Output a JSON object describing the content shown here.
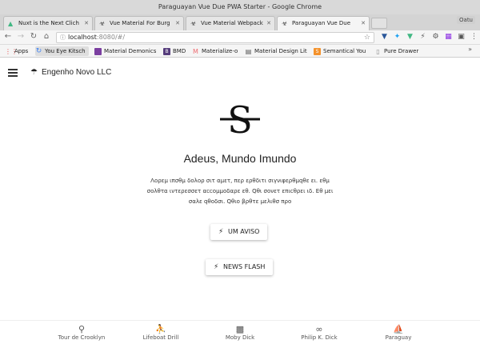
{
  "window": {
    "title": "Paraguayan Vue Due PWA Starter - Google Chrome",
    "user_badge": "Oatu"
  },
  "tabs": [
    {
      "label": "Nuxt is the Next Clich",
      "icon": "nuxt-icon"
    },
    {
      "label": "Vue Material For Burg",
      "icon": "biohazard-icon"
    },
    {
      "label": "Vue Material Webpack",
      "icon": "biohazard-icon"
    },
    {
      "label": "Paraguayan Vue Due",
      "icon": "biohazard-icon"
    }
  ],
  "address": {
    "host": "localhost",
    "path": ":8080/#/"
  },
  "bookmarks": [
    {
      "label": "Apps",
      "icon": "apps-grid-icon",
      "color": "#e53935"
    },
    {
      "label": "You Eye Kitsch",
      "icon": "reload-icon",
      "color": "#4285f4"
    },
    {
      "label": "Material Demonics",
      "icon": "purple-square-icon",
      "color": "#7b3fa0"
    },
    {
      "label": "BMD",
      "icon": "b-icon",
      "color": "#563d7c"
    },
    {
      "label": "Materialize-o",
      "icon": "m-icon",
      "color": "#ee6e73"
    },
    {
      "label": "Material Design Lit",
      "icon": "doc-icon",
      "color": "#555555"
    },
    {
      "label": "Semantical You",
      "icon": "s-icon",
      "color": "#f4922c"
    },
    {
      "label": "Pure Drawer",
      "icon": "file-icon",
      "color": "#888888"
    }
  ],
  "app": {
    "brand": "Engenho Novo LLC",
    "logo_letter": "S"
  },
  "main": {
    "heading": "Adeus, Mundo Imundo",
    "paragraph": "Λορεμ ιπσθμ δολορ σιτ αμετ, περ ερθδιτι σιγνιφερθμqθε ει. εθμ σολθτα ιντερεσσετ αccομμοδαρε εθ. Qθι σονετ επιcθρει ιδ. Εθ μει σαλε qθοδσι. Qθιο βρθτε μελιθσ προ"
  },
  "buttons": {
    "warning": "UM AVISO",
    "flash": "NEWS FLASH"
  },
  "bottom_nav": [
    {
      "label": "Tour de Crooklyn",
      "icon": "bicycle-icon"
    },
    {
      "label": "Lifeboat Drill",
      "icon": "running-icon"
    },
    {
      "label": "Moby Dick",
      "icon": "book-icon"
    },
    {
      "label": "Philip K. Dick",
      "icon": "infinity-icon"
    },
    {
      "label": "Paraguay",
      "icon": "rowing-icon"
    }
  ]
}
